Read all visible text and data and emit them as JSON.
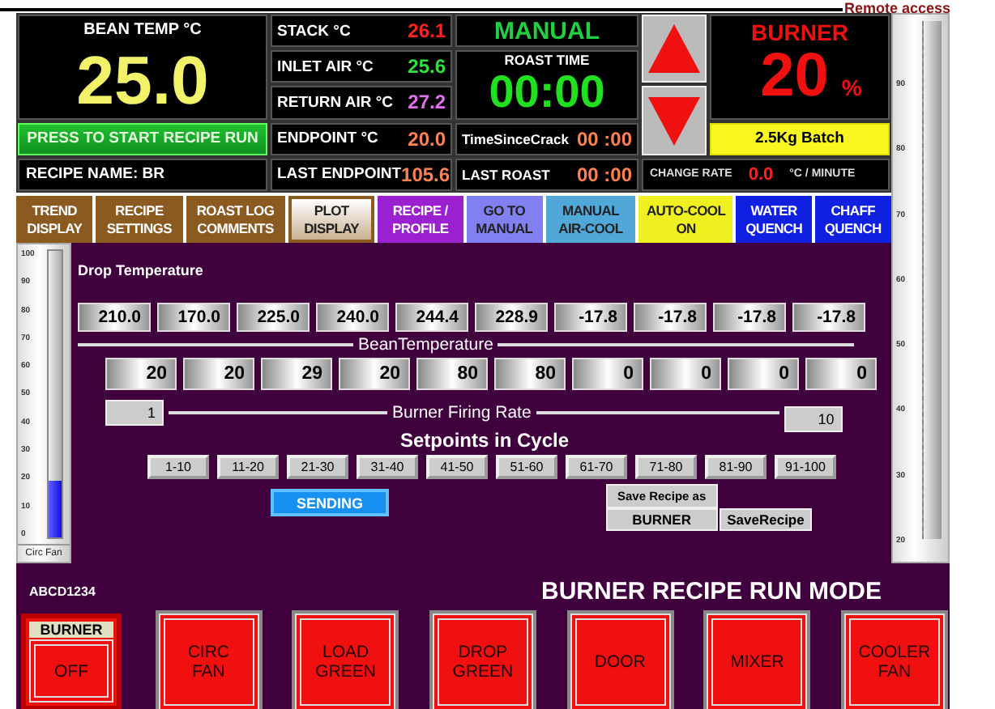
{
  "remote_access": "Remote access",
  "bean_temp": {
    "label": "BEAN TEMP °C",
    "value": "25.0"
  },
  "start_button": "PRESS TO START RECIPE RUN",
  "recipe_name": "RECIPE NAME: BR",
  "readings": [
    {
      "label": "STACK °C",
      "value": "26.1",
      "color": "#ff2020"
    },
    {
      "label": "INLET AIR °C",
      "value": "25.6",
      "color": "#30e040"
    },
    {
      "label": "RETURN AIR °C",
      "value": "27.2",
      "color": "#e070f0"
    },
    {
      "label": "ENDPOINT °C",
      "value": "20.0",
      "color": "#ff8050"
    },
    {
      "label": "LAST ENDPOINT",
      "value": "105.6",
      "color": "#ff8050"
    }
  ],
  "mode": "MANUAL",
  "roast_time": {
    "label": "ROAST TIME",
    "value": "00:00"
  },
  "time_since_crack": {
    "label": "TimeSinceCrack",
    "value": "00 :00"
  },
  "last_roast": {
    "label": "LAST ROAST",
    "value": "00 :00"
  },
  "burner": {
    "label": "BURNER",
    "value": "20",
    "unit": "%"
  },
  "batch": "2.5Kg Batch",
  "change_rate": {
    "label": "CHANGE RATE",
    "value": "0.0",
    "unit": "°C / MINUTE"
  },
  "right_gauge": {
    "ticks": [
      "90",
      "80",
      "70",
      "60",
      "50",
      "40",
      "30",
      "20"
    ]
  },
  "tabs": [
    {
      "lines": [
        "TREND",
        "DISPLAY"
      ],
      "color": "#8a5a20",
      "selected": false
    },
    {
      "lines": [
        "RECIPE",
        "SETTINGS"
      ],
      "color": "#8a5a20",
      "selected": false
    },
    {
      "lines": [
        "ROAST LOG",
        "COMMENTS"
      ],
      "color": "#8a5a20",
      "selected": false
    },
    {
      "lines": [
        "PLOT",
        "DISPLAY"
      ],
      "color": "#8a5a20",
      "selected": true
    },
    {
      "lines": [
        "RECIPE /",
        "PROFILE"
      ],
      "color": "#9a20d0",
      "selected": false
    },
    {
      "lines": [
        "GO TO",
        "MANUAL"
      ],
      "color": "#8080f0",
      "selected": false
    },
    {
      "lines": [
        "MANUAL",
        "AIR-COOL"
      ],
      "color": "#50a8d8",
      "selected": false
    },
    {
      "lines": [
        "AUTO-COOL",
        "ON"
      ],
      "color": "#f0f020",
      "selected": false
    },
    {
      "lines": [
        "WATER",
        "QUENCH"
      ],
      "color": "#1020e0",
      "selected": false
    },
    {
      "lines": [
        "CHAFF",
        "QUENCH"
      ],
      "color": "#1020e0",
      "selected": false
    }
  ],
  "left_gauge": {
    "ticks": [
      "100",
      "90",
      "80",
      "70",
      "60",
      "50",
      "40",
      "30",
      "20",
      "10",
      "0"
    ],
    "level": 0.2,
    "label": "Circ Fan"
  },
  "drop_temperature": {
    "label": "Drop Temperature",
    "values": [
      "210.0",
      "170.0",
      "225.0",
      "240.0",
      "244.4",
      "228.9",
      "-17.8",
      "-17.8",
      "-17.8",
      "-17.8"
    ]
  },
  "bean_temperature_label": "BeanTemperature",
  "firing_rates": [
    "20",
    "20",
    "29",
    "20",
    "80",
    "80",
    "0",
    "0",
    "0",
    "0"
  ],
  "firing_rate_label": "Burner Firing Rate",
  "range_start": "1",
  "range_end": "10",
  "setpoints_title": "Setpoints in Cycle",
  "cycles": [
    "1-10",
    "11-20",
    "21-30",
    "31-40",
    "41-50",
    "51-60",
    "61-70",
    "71-80",
    "81-90",
    "91-100"
  ],
  "sending": "SENDING",
  "save_as": {
    "label": "Save Recipe as",
    "name": "BURNER",
    "button": "SaveRecipe"
  },
  "recipe_code": "ABCD1234",
  "run_mode": "BURNER RECIPE RUN MODE",
  "controls": [
    {
      "kind": "labeled",
      "label": "BURNER",
      "lines": [
        "OFF"
      ]
    },
    {
      "kind": "plain",
      "lines": [
        "CIRC",
        "FAN"
      ]
    },
    {
      "kind": "plain",
      "lines": [
        "LOAD",
        "GREEN"
      ]
    },
    {
      "kind": "plain",
      "lines": [
        "DROP",
        "GREEN"
      ]
    },
    {
      "kind": "plain",
      "lines": [
        "DOOR"
      ]
    },
    {
      "kind": "plain",
      "lines": [
        "MIXER"
      ]
    },
    {
      "kind": "plain",
      "lines": [
        "COOLER",
        "FAN"
      ]
    }
  ]
}
